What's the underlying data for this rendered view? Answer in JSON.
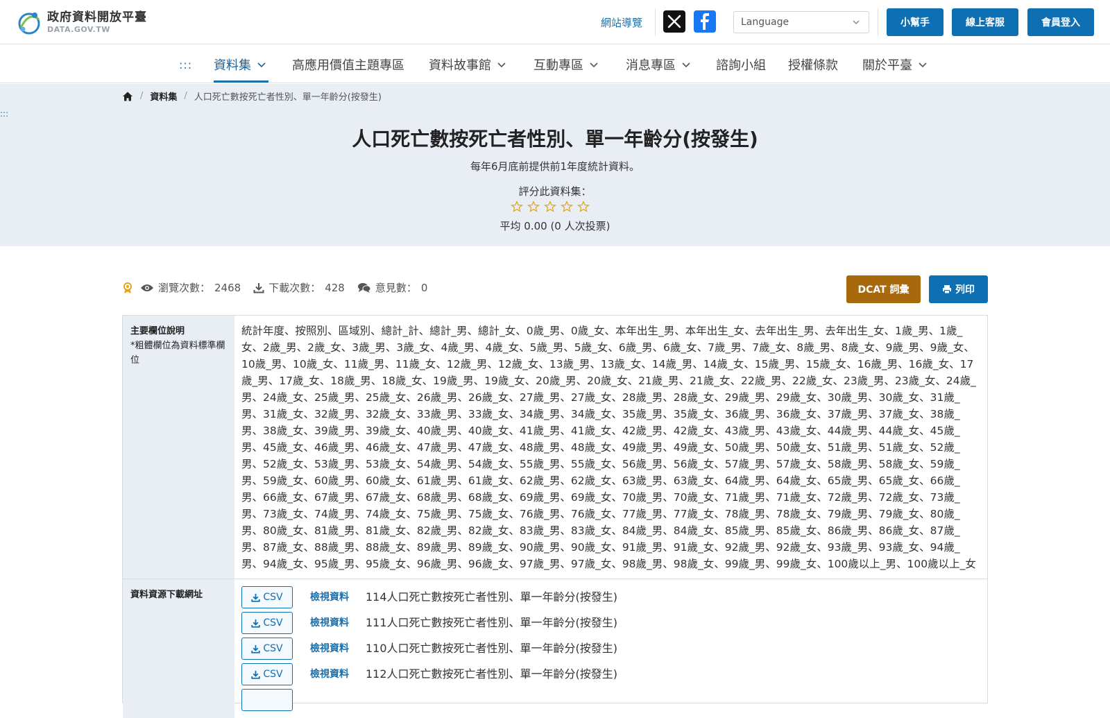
{
  "header": {
    "logo_zh": "政府資料開放平臺",
    "logo_en": "DATA.GOV.TW",
    "sitemap": "網站導覽",
    "language_placeholder": "Language",
    "help": "小幫手",
    "service": "線上客服",
    "login": "會員登入"
  },
  "nav": {
    "dots": ":::",
    "items": [
      "資料集",
      "高應用價值主題專區",
      "資料故事館",
      "互動專區",
      "消息專區",
      "諮詢小組",
      "授權條款",
      "關於平臺"
    ]
  },
  "breadcrumb": {
    "dataset": "資料集",
    "current": "人口死亡數按死亡者性別、單一年齡分(按發生)"
  },
  "hero": {
    "dots": ":::",
    "title": "人口死亡數按死亡者性別、單一年齡分(按發生)",
    "subtitle": "每年6月底前提供前1年度統計資料。",
    "rate_label": "評分此資料集：",
    "avg": "平均 0.00 (0 人次投票)"
  },
  "stats": {
    "views_label": "瀏覽次數：",
    "views": "2468",
    "downloads_label": "下載次數：",
    "downloads": "428",
    "comments_label": "意見數：",
    "comments": "0"
  },
  "actions": {
    "dcat": "DCAT 詞彙",
    "print": "列印"
  },
  "details": {
    "fields_title": "主要欄位說明",
    "fields_note": "*粗體欄位為資料標準欄位",
    "fields_text": "統計年度、按照別、區域別、總計_計、總計_男、總計_女、0歲_男、0歲_女、本年出生_男、本年出生_女、去年出生_男、去年出生_女、1歲_男、1歲_女、2歲_男、2歲_女、3歲_男、3歲_女、4歲_男、4歲_女、5歲_男、5歲_女、6歲_男、6歲_女、7歲_男、7歲_女、8歲_男、8歲_女、9歲_男、9歲_女、10歲_男、10歲_女、11歲_男、11歲_女、12歲_男、12歲_女、13歲_男、13歲_女、14歲_男、14歲_女、15歲_男、15歲_女、16歲_男、16歲_女、17歲_男、17歲_女、18歲_男、18歲_女、19歲_男、19歲_女、20歲_男、20歲_女、21歲_男、21歲_女、22歲_男、22歲_女、23歲_男、23歲_女、24歲_男、24歲_女、25歲_男、25歲_女、26歲_男、26歲_女、27歲_男、27歲_女、28歲_男、28歲_女、29歲_男、29歲_女、30歲_男、30歲_女、31歲_男、31歲_女、32歲_男、32歲_女、33歲_男、33歲_女、34歲_男、34歲_女、35歲_男、35歲_女、36歲_男、36歲_女、37歲_男、37歲_女、38歲_男、38歲_女、39歲_男、39歲_女、40歲_男、40歲_女、41歲_男、41歲_女、42歲_男、42歲_女、43歲_男、43歲_女、44歲_男、44歲_女、45歲_男、45歲_女、46歲_男、46歲_女、47歲_男、47歲_女、48歲_男、48歲_女、49歲_男、49歲_女、50歲_男、50歲_女、51歲_男、51歲_女、52歲_男、52歲_女、53歲_男、53歲_女、54歲_男、54歲_女、55歲_男、55歲_女、56歲_男、56歲_女、57歲_男、57歲_女、58歲_男、58歲_女、59歲_男、59歲_女、60歲_男、60歲_女、61歲_男、61歲_女、62歲_男、62歲_女、63歲_男、63歲_女、64歲_男、64歲_女、65歲_男、65歲_女、66歲_男、66歲_女、67歲_男、67歲_女、68歲_男、68歲_女、69歲_男、69歲_女、70歲_男、70歲_女、71歲_男、71歲_女、72歲_男、72歲_女、73歲_男、73歲_女、74歲_男、74歲_女、75歲_男、75歲_女、76歲_男、76歲_女、77歲_男、77歲_女、78歲_男、78歲_女、79歲_男、79歲_女、80歲_男、80歲_女、81歲_男、81歲_女、82歲_男、82歲_女、83歲_男、83歲_女、84歲_男、84歲_女、85歲_男、85歲_女、86歲_男、86歲_女、87歲_男、87歲_女、88歲_男、88歲_女、89歲_男、89歲_女、90歲_男、90歲_女、91歲_男、91歲_女、92歲_男、92歲_女、93歲_男、93歲_女、94歲_男、94歲_女、95歲_男、95歲_女、96歲_男、96歲_女、97歲_男、97歲_女、98歲_男、98歲_女、99歲_男、99歲_女、100歲以上_男、100歲以上_女",
    "resources_title": "資料資源下載網址",
    "resources": [
      {
        "format": "CSV",
        "view": "檢視資料",
        "name": "114人口死亡數按死亡者性別、單一年齡分(按發生)"
      },
      {
        "format": "CSV",
        "view": "檢視資料",
        "name": "111人口死亡數按死亡者性別、單一年齡分(按發生)"
      },
      {
        "format": "CSV",
        "view": "檢視資料",
        "name": "110人口死亡數按死亡者性別、單一年齡分(按發生)"
      },
      {
        "format": "CSV",
        "view": "檢視資料",
        "name": "112人口死亡數按死亡者性別、單一年齡分(按發生)"
      }
    ]
  },
  "colors": {
    "primary": "#0f6fb3",
    "dcat": "#a7690b",
    "hero_bg": "#e8eef4",
    "star": "#e8a317"
  }
}
